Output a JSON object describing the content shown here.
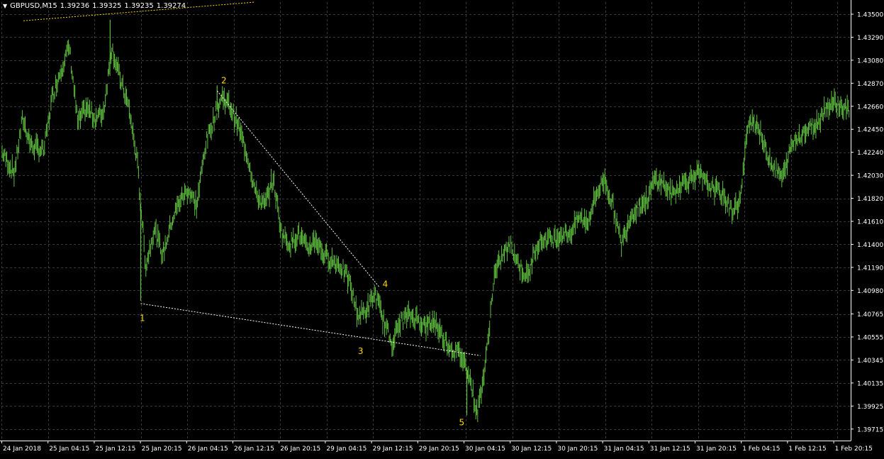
{
  "header": {
    "menu_arrow": "▼",
    "symbol": "GBPUSD,M15",
    "open": "1.39236",
    "high": "1.39325",
    "low": "1.39235",
    "close": "1.39274"
  },
  "colors": {
    "background": "#000000",
    "grid": "#3a3a3a",
    "candles": "#5fbf3f",
    "axis_text": "#ffffff",
    "trendline": "#ffffff",
    "wave_labels": "#ffd700",
    "top_line": "#ffd700"
  },
  "chart_data": {
    "type": "line",
    "ylim": [
      1.3961,
      1.4361
    ],
    "y_ticks": [
      "1.43500",
      "1.43290",
      "1.43080",
      "1.42870",
      "1.42660",
      "1.42450",
      "1.42240",
      "1.42030",
      "1.41820",
      "1.41610",
      "1.41400",
      "1.41190",
      "1.40980",
      "1.40765",
      "1.40555",
      "1.40345",
      "1.40135",
      "1.39925",
      "1.39715"
    ],
    "x_ticks": [
      "24 Jan 2018",
      "25 Jan 04:15",
      "25 Jan 12:15",
      "25 Jan 20:15",
      "26 Jan 04:15",
      "26 Jan 12:15",
      "26 Jan 20:15",
      "29 Jan 04:15",
      "29 Jan 12:15",
      "29 Jan 20:15",
      "30 Jan 04:15",
      "30 Jan 12:15",
      "30 Jan 20:15",
      "31 Jan 04:15",
      "31 Jan 12:15",
      "31 Jan 20:15",
      "1 Feb 04:15",
      "1 Feb 12:15",
      "1 Feb 20:15"
    ],
    "x_range": [
      0,
      100
    ],
    "series": [
      {
        "points": [
          [
            0,
            1.4225
          ],
          [
            1.5,
            1.4205
          ],
          [
            2.5,
            1.4255
          ],
          [
            3.5,
            1.423
          ],
          [
            5,
            1.4225
          ],
          [
            6,
            1.4275
          ],
          [
            7,
            1.43
          ],
          [
            8,
            1.432
          ],
          [
            9,
            1.425
          ],
          [
            10,
            1.4265
          ],
          [
            11,
            1.4255
          ],
          [
            12,
            1.426
          ],
          [
            13,
            1.432
          ],
          [
            14,
            1.429
          ],
          [
            15,
            1.4265
          ],
          [
            16,
            1.4215
          ],
          [
            17,
            1.412
          ],
          [
            18,
            1.4155
          ],
          [
            19,
            1.413
          ],
          [
            20,
            1.416
          ],
          [
            21,
            1.418
          ],
          [
            22,
            1.419
          ],
          [
            23,
            1.4175
          ],
          [
            24,
            1.423
          ],
          [
            25,
            1.4255
          ],
          [
            26,
            1.4275
          ],
          [
            27,
            1.4265
          ],
          [
            28,
            1.4245
          ],
          [
            29,
            1.422
          ],
          [
            30,
            1.4185
          ],
          [
            31,
            1.4175
          ],
          [
            32,
            1.42
          ],
          [
            33,
            1.415
          ],
          [
            34,
            1.414
          ],
          [
            35,
            1.415
          ],
          [
            36,
            1.4135
          ],
          [
            37,
            1.4145
          ],
          [
            38,
            1.413
          ],
          [
            39,
            1.4125
          ],
          [
            40,
            1.412
          ],
          [
            41,
            1.4105
          ],
          [
            42,
            1.4075
          ],
          [
            43,
            1.408
          ],
          [
            44,
            1.4095
          ],
          [
            45,
            1.407
          ],
          [
            46,
            1.405
          ],
          [
            47,
            1.407
          ],
          [
            48,
            1.4075
          ],
          [
            49,
            1.4072
          ],
          [
            50,
            1.4065
          ],
          [
            51,
            1.407
          ],
          [
            52,
            1.4055
          ],
          [
            53,
            1.4045
          ],
          [
            54,
            1.404
          ],
          [
            55,
            1.4025
          ],
          [
            56,
            1.3985
          ],
          [
            57,
            1.403
          ],
          [
            58,
            1.411
          ],
          [
            59,
            1.413
          ],
          [
            60,
            1.414
          ],
          [
            61,
            1.412
          ],
          [
            62,
            1.411
          ],
          [
            63,
            1.414
          ],
          [
            64,
            1.4145
          ],
          [
            65,
            1.4145
          ],
          [
            66,
            1.415
          ],
          [
            67,
            1.415
          ],
          [
            68,
            1.4165
          ],
          [
            69,
            1.416
          ],
          [
            70,
            1.4185
          ],
          [
            71,
            1.42
          ],
          [
            72,
            1.4175
          ],
          [
            73,
            1.414
          ],
          [
            74,
            1.4165
          ],
          [
            75,
            1.4175
          ],
          [
            76,
            1.418
          ],
          [
            77,
            1.42
          ],
          [
            78,
            1.4195
          ],
          [
            79,
            1.4185
          ],
          [
            80,
            1.4195
          ],
          [
            81,
            1.42
          ],
          [
            82,
            1.4205
          ],
          [
            83,
            1.4195
          ],
          [
            84,
            1.419
          ],
          [
            85,
            1.4185
          ],
          [
            86,
            1.417
          ],
          [
            87,
            1.418
          ],
          [
            88,
            1.4255
          ],
          [
            89,
            1.425
          ],
          [
            90,
            1.4225
          ],
          [
            91,
            1.421
          ],
          [
            92,
            1.42
          ],
          [
            93,
            1.423
          ],
          [
            94,
            1.424
          ],
          [
            95,
            1.4245
          ],
          [
            96,
            1.425
          ],
          [
            97,
            1.4265
          ],
          [
            98,
            1.427
          ],
          [
            99,
            1.4265
          ],
          [
            100,
            1.4262
          ]
        ]
      }
    ],
    "extremes": [
      {
        "x": 12.8,
        "y": 1.4345
      },
      {
        "x": 16.4,
        "y": 1.40885
      },
      {
        "x": 25.4,
        "y": 1.4285
      },
      {
        "x": 54.8,
        "y": 1.3984
      }
    ],
    "trendlines": [
      {
        "points": [
          [
            16.4,
            1.4086
          ],
          [
            56.4,
            1.40385
          ]
        ],
        "style": "dotted",
        "color": "#ffffff"
      },
      {
        "points": [
          [
            25.4,
            1.428
          ],
          [
            44.5,
            1.4101
          ]
        ],
        "style": "dotted",
        "color": "#ffffff"
      },
      {
        "points": [
          [
            2.6,
            1.4344
          ],
          [
            29.8,
            1.4361
          ]
        ],
        "style": "dotted",
        "color": "#ffd700"
      }
    ],
    "wave_labels": [
      {
        "text": "1",
        "x": 16.6,
        "y": 1.407
      },
      {
        "text": "2",
        "x": 26.2,
        "y": 1.4287
      },
      {
        "text": "3",
        "x": 42.3,
        "y": 1.404
      },
      {
        "text": "4",
        "x": 45.2,
        "y": 1.4101
      },
      {
        "text": "5",
        "x": 54.2,
        "y": 1.3975
      }
    ]
  }
}
